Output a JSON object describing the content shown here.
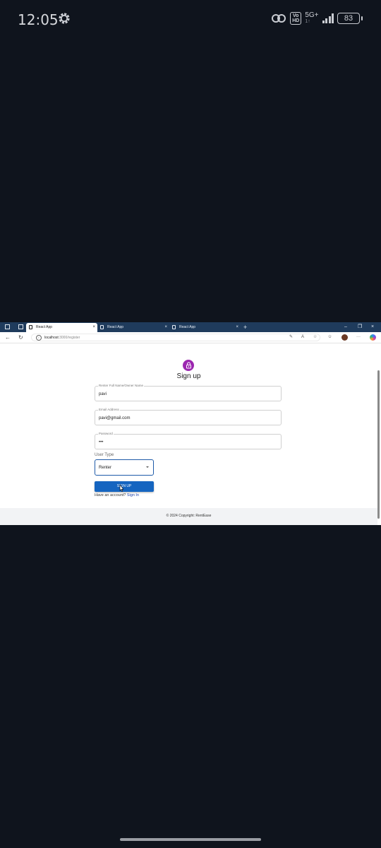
{
  "status_bar": {
    "time": "12:05",
    "icons": [
      "gear-icon",
      "link-icon",
      "volte-icon",
      "signal-icon",
      "battery-icon"
    ],
    "volte_top": "Vo",
    "volte_bottom": "HD",
    "network": "5G+",
    "network_sub": "1↑",
    "battery": "83"
  },
  "browser": {
    "tabs": [
      {
        "title": "React App",
        "active": true
      },
      {
        "title": "React App",
        "active": false
      },
      {
        "title": "React App",
        "active": false
      }
    ],
    "tab_close": "×",
    "new_tab": "+",
    "window_controls": {
      "minimize": "–",
      "restore": "❐",
      "close": "×"
    },
    "url_host": "localhost",
    "url_path": ":3000/register",
    "toolbar_more": "···"
  },
  "page": {
    "title": "Sign up",
    "fields": {
      "name": {
        "label": "Renter Full Name/Owner Name",
        "value": "pavi"
      },
      "email": {
        "label": "Email Address",
        "value": "pavi@gmail.com"
      },
      "password": {
        "label": "Password",
        "value": "•••"
      }
    },
    "user_type_label": "User Type",
    "user_type_value": "Renter",
    "signup_button": "SIGN UP",
    "have_account": "Have an account?",
    "signin_link": "Sign In",
    "footer": "© 2024 Copyright: RentEase"
  },
  "colors": {
    "background": "#0f141d",
    "tab_bar": "#1f3b5c",
    "accent_button": "#1565c0",
    "lock_avatar": "#9c27b0"
  }
}
